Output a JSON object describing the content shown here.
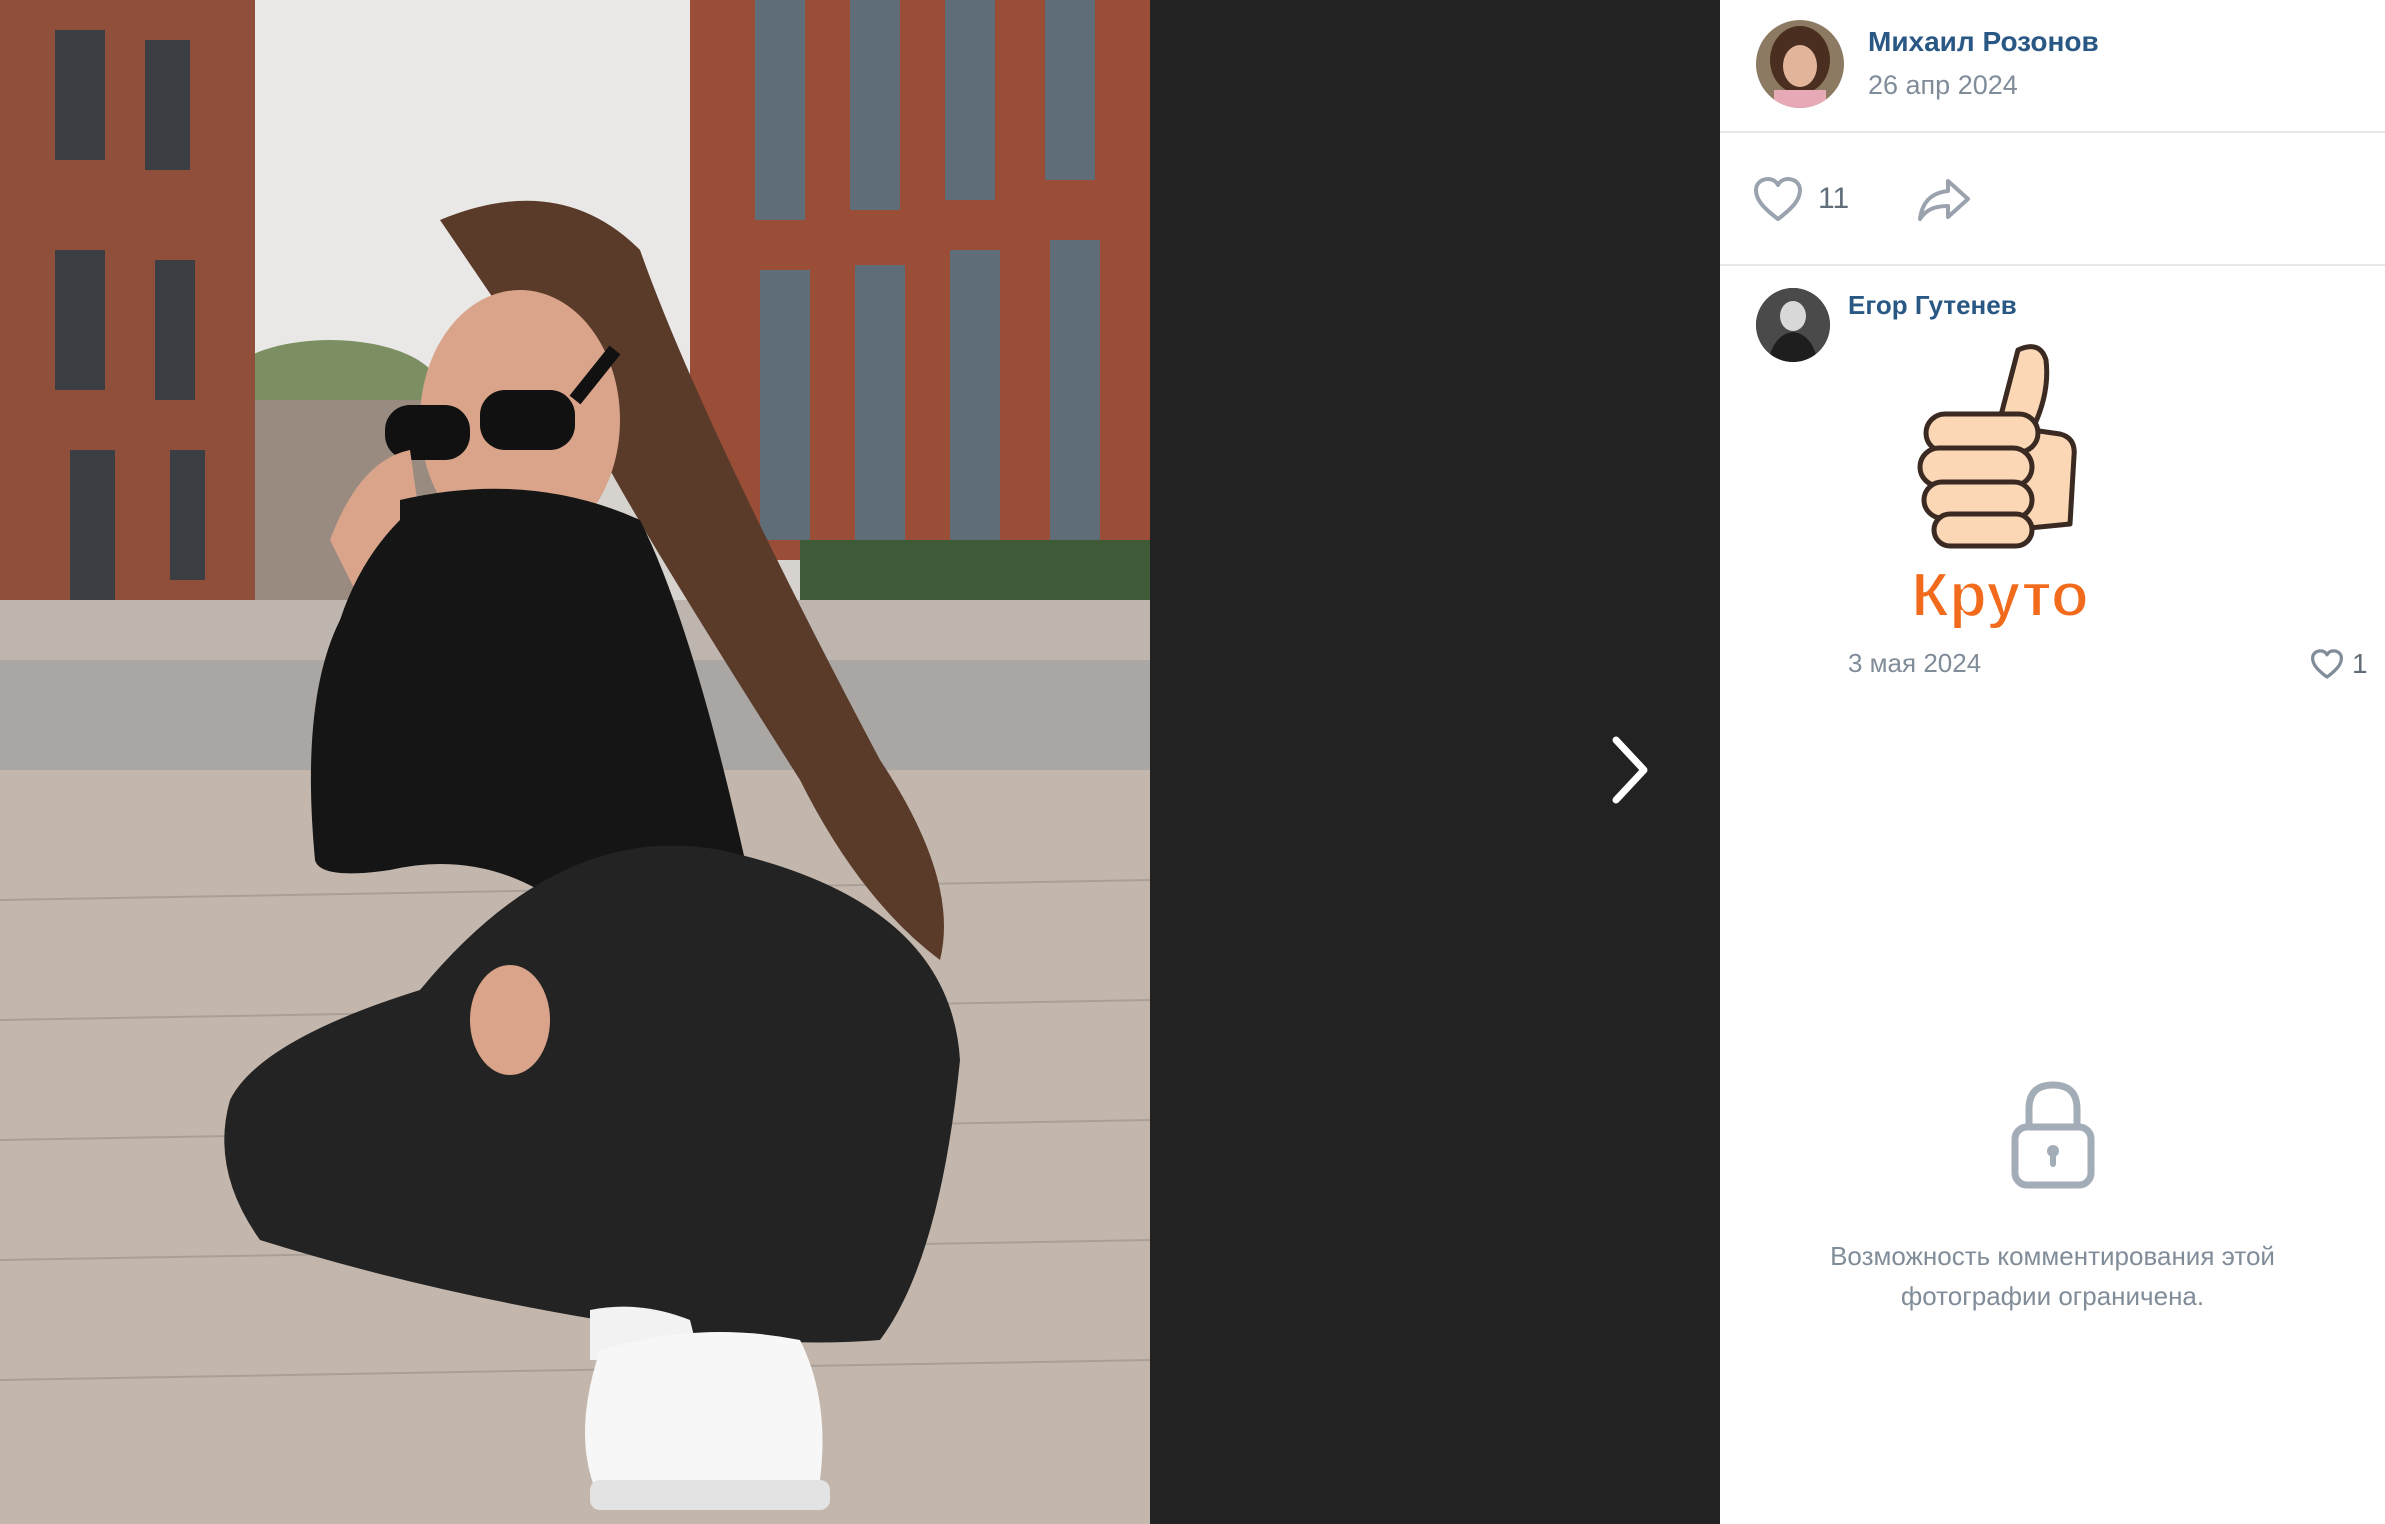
{
  "post": {
    "author_name": "Михаил Розонов",
    "date": "26 апр 2024",
    "likes": "11"
  },
  "comment": {
    "author_name": "Егор Гутенев",
    "sticker_text": "Круто",
    "date": "3 мая 2024",
    "likes": "1"
  },
  "comments_closed": {
    "text": "Возможность комментирования этой фотографии ограничена."
  },
  "icons": {
    "next": "chevron-right-icon",
    "like": "heart-outline-icon",
    "share": "share-arrow-icon",
    "lock": "lock-icon"
  },
  "colors": {
    "link": "#2a5885",
    "secondary_text": "#818c99",
    "stage_background": "#222222",
    "divider": "#e7e8ec",
    "sticker_text": "#f26a1b"
  }
}
